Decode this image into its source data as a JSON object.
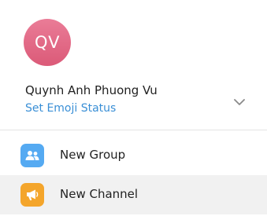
{
  "profile": {
    "initials": "QV",
    "name": "Quynh Anh Phuong Vu",
    "status_link": "Set Emoji Status",
    "avatar_colors": [
      "#ea7c97",
      "#db5a78"
    ],
    "expand_icon": "chevron-down-icon"
  },
  "menu": {
    "items": [
      {
        "label": "New Group",
        "icon": "group-icon",
        "icon_color": "#55aaf2"
      },
      {
        "label": "New Channel",
        "icon": "megaphone-icon",
        "icon_color": "#f4a52b"
      }
    ]
  },
  "colors": {
    "link": "#3a8fd6",
    "text": "#222222",
    "hover_background": "#f1f1f1"
  }
}
